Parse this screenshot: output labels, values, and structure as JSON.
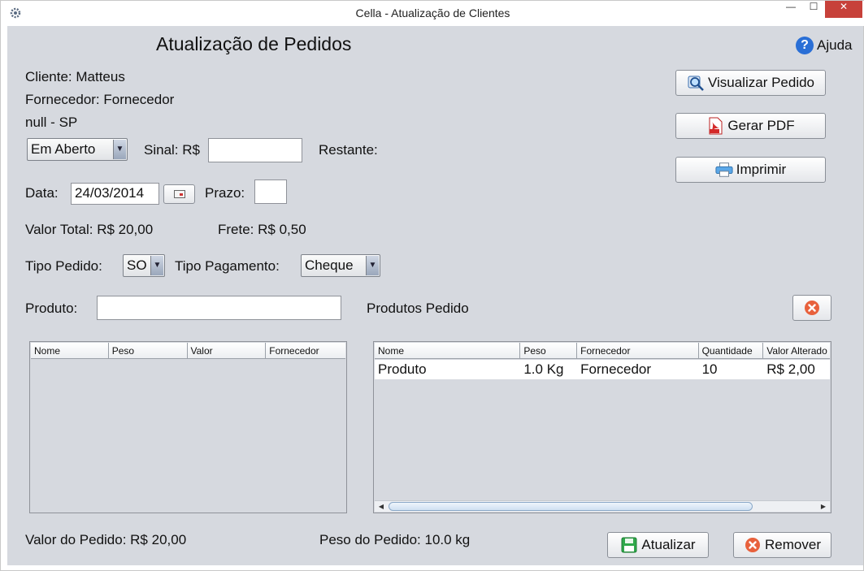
{
  "window": {
    "title": "Cella - Atualização de Clientes",
    "min_symbol": "—",
    "max_symbol": "☐",
    "close_symbol": "✕"
  },
  "heading": "Atualização de Pedidos",
  "help": {
    "symbol": "?",
    "label": "Ajuda"
  },
  "info": {
    "cliente": "Cliente: Matteus",
    "fornecedor": "Fornecedor: Fornecedor",
    "local": "null - SP"
  },
  "status_select": {
    "value": "Em Aberto"
  },
  "sinal": {
    "label": "Sinal: R$",
    "value": ""
  },
  "restante": {
    "label": "Restante:"
  },
  "data": {
    "label": "Data:",
    "value": "24/03/2014"
  },
  "prazo": {
    "label": "Prazo:",
    "value": ""
  },
  "valor_total": "Valor Total: R$ 20,00",
  "frete": "Frete: R$ 0,50",
  "tipo_pedido": {
    "label": "Tipo Pedido:",
    "value": "SO"
  },
  "tipo_pagamento": {
    "label": "Tipo Pagamento:",
    "value": "Cheque"
  },
  "produto": {
    "label": "Produto:",
    "value": ""
  },
  "produtos_pedido_label": "Produtos Pedido",
  "buttons": {
    "visualizar": "Visualizar Pedido",
    "gerar_pdf": "Gerar PDF",
    "imprimir": "Imprimir",
    "atualizar": "Atualizar",
    "remover": "Remover"
  },
  "left_table": {
    "columns": [
      "Nome",
      "Peso",
      "Valor",
      "Fornecedor"
    ],
    "rows": []
  },
  "right_table": {
    "columns": [
      "Nome",
      "Peso",
      "Fornecedor",
      "Quantidade",
      "Valor Alterado"
    ],
    "rows": [
      [
        "Produto",
        "1.0 Kg",
        "Fornecedor",
        "10",
        "R$ 2,00"
      ]
    ]
  },
  "footer": {
    "valor_pedido": "Valor do Pedido: R$ 20,00",
    "peso_pedido": "Peso do Pedido: 10.0 kg"
  },
  "colors": {
    "panel_bg": "#d6d9df",
    "help_icon": "#2a6fd6",
    "pdf_icon": "#d42a2a",
    "save_icon": "#2fa84a",
    "remove_icon": "#e8613c",
    "print_icon": "#5aa7e8"
  },
  "icons": {
    "app": "gear-icon",
    "calendar": "calendar-icon",
    "visualizar": "magnifier-icon",
    "pdf": "pdf-icon",
    "print": "printer-icon",
    "clear": "remove-circle-icon",
    "save": "save-icon",
    "remove": "remove-circle-icon"
  }
}
